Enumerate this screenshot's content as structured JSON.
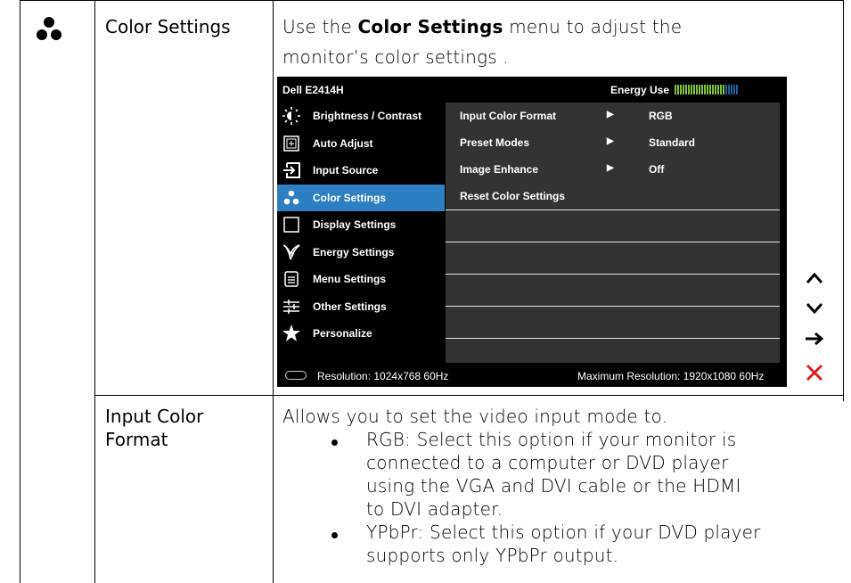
{
  "row1": {
    "title": "Color Settings",
    "desc_pre": "Use the ",
    "desc_bold": "Color Settings",
    "desc_post1": " menu to adjust the",
    "desc_post2": "monitor’s color settings ."
  },
  "osd": {
    "model": "Dell E2414H",
    "energy_label": "Energy Use",
    "energy_level": 0.8,
    "menu": [
      {
        "label": "Brightness / Contrast",
        "icon": "brightness-icon"
      },
      {
        "label": "Auto Adjust",
        "icon": "auto-adjust-icon"
      },
      {
        "label": "Input Source",
        "icon": "input-source-icon"
      },
      {
        "label": "Color Settings",
        "icon": "color-settings-icon",
        "active": true
      },
      {
        "label": "Display Settings",
        "icon": "display-settings-icon"
      },
      {
        "label": "Energy Settings",
        "icon": "energy-settings-icon"
      },
      {
        "label": "Menu Settings",
        "icon": "menu-settings-icon"
      },
      {
        "label": "Other Settings",
        "icon": "other-settings-icon"
      },
      {
        "label": "Personalize",
        "icon": "personalize-icon"
      }
    ],
    "options": [
      {
        "label": "Input Color Format",
        "value": "RGB"
      },
      {
        "label": "Preset Modes",
        "value": "Standard"
      },
      {
        "label": "Image Enhance",
        "value": "Off"
      },
      {
        "label": "Reset Color Settings",
        "value": ""
      }
    ],
    "resolution": "Resolution:  1024x768 60Hz",
    "max_resolution": "Maximum Resolution: 1920x1080 60Hz",
    "accent_color": "#2d7fc2",
    "energy_color": "#7ec23a"
  },
  "side_buttons": [
    "up-icon",
    "down-icon",
    "right-arrow-icon",
    "close-icon"
  ],
  "row2": {
    "title_line1": "Input Color",
    "title_line2": "Format",
    "intro": "Allows you to set the video input mode to.",
    "bullet1": [
      "RGB: Select this option if your monitor is",
      "connected to a computer or DVD player",
      "using the VGA and DVI cable or the HDMI",
      "to DVI adapter."
    ],
    "bullet2": [
      "YPbPr: Select this option if your DVD player",
      "supports only YPbPr output."
    ]
  }
}
